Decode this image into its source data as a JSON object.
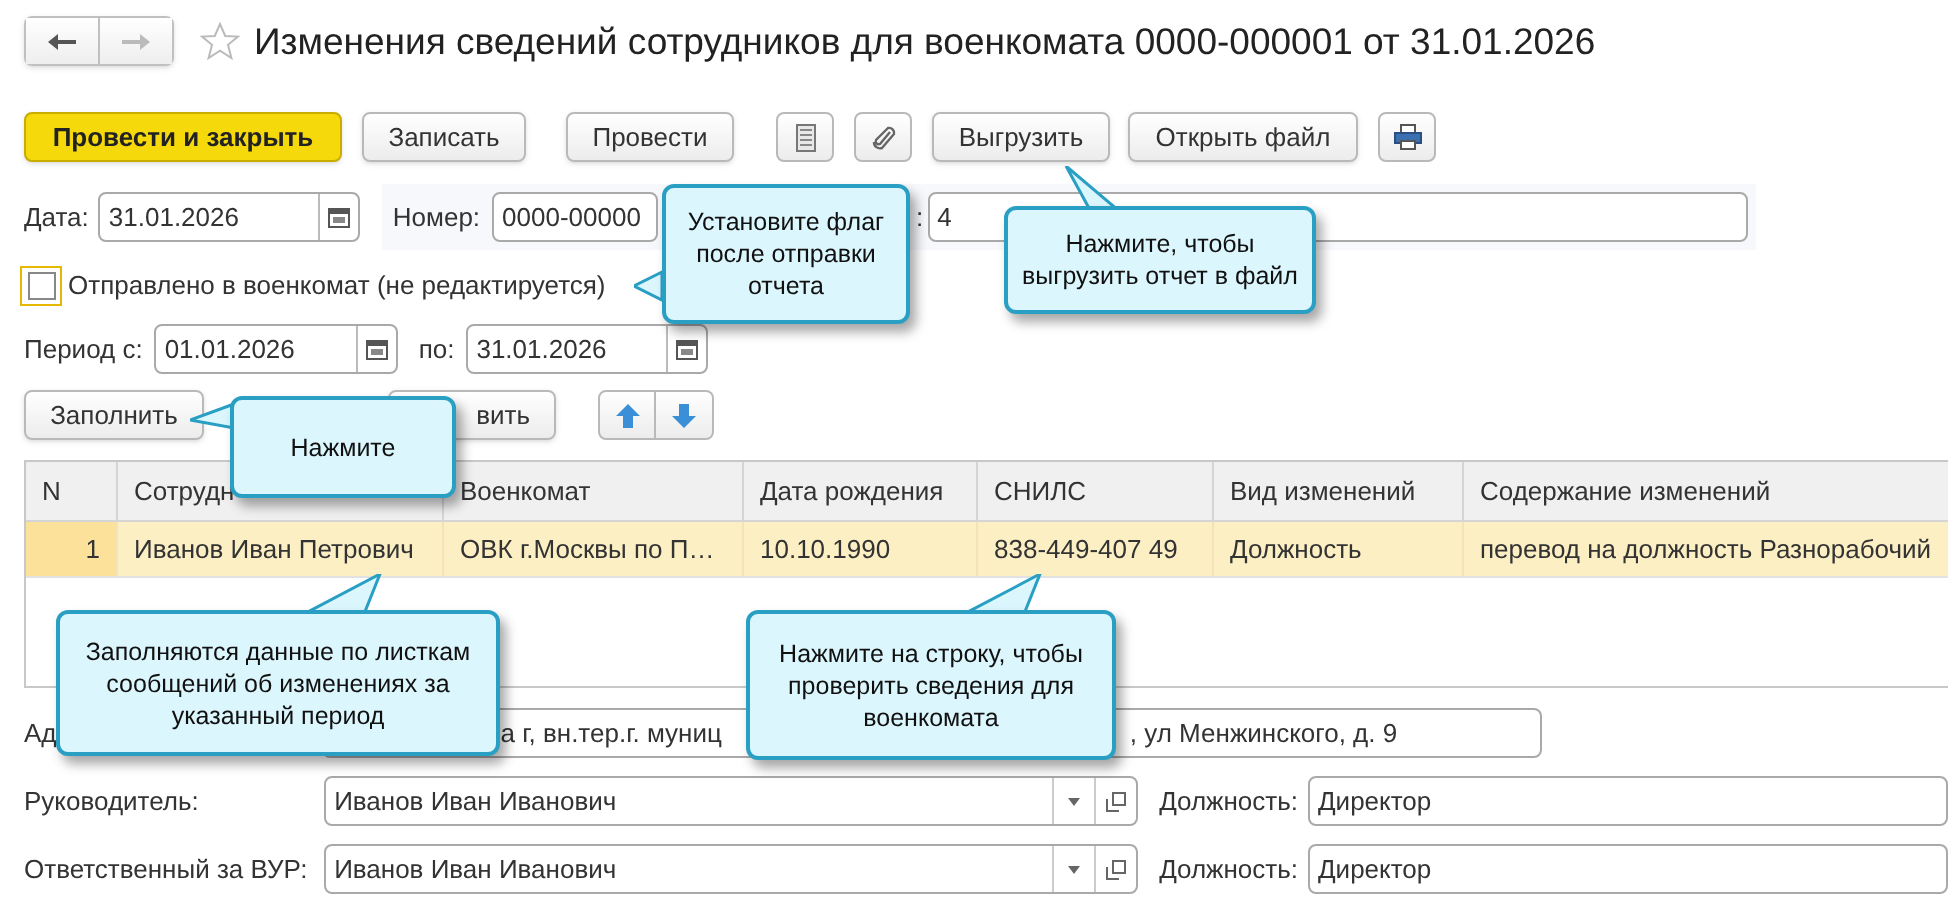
{
  "title": "Изменения сведений сотрудников для военкомата 0000-000001 от 31.01.2026",
  "favorite": false,
  "main_buttons": [
    {
      "kind": "primary",
      "label": "Провести и закрыть"
    },
    {
      "kind": "plain",
      "label": "Записать"
    },
    {
      "kind": "plain",
      "label": "Провести"
    }
  ],
  "file_buttons": [
    {
      "label": "Выгрузить"
    },
    {
      "label": "Открыть файл"
    }
  ],
  "date": {
    "label": "Дата:",
    "value": "31.01.2026"
  },
  "number": {
    "label": "Номер:",
    "value": "0000-00000"
  },
  "field_3": {
    "label": ":",
    "value": "4"
  },
  "sent": {
    "label": "Отправлено в военкомат (не редактируется)",
    "checked": false
  },
  "period": {
    "from_label": "Период с:",
    "from": "01.01.2026",
    "to_label": "по:",
    "to": "31.01.2026"
  },
  "fill_button": "Заполнить",
  "button_3": "вить",
  "table": {
    "columns": [
      "N",
      "Сотрудн",
      "Военкомат",
      "Дата рождения",
      "СНИЛС",
      "Вид изменений",
      "Содержание изменений"
    ],
    "rows": [
      {
        "selected": true,
        "cells": [
          "1",
          "Иванов Иван Петрович",
          "ОВК г.Москвы по П…",
          "10.10.1990",
          "838-449-407 49",
          "Должность",
          "перевод на должность Разнорабочий"
        ]
      }
    ]
  },
  "address": {
    "label": "Ад",
    "value_part_1": "а г, вн.тер.г. муниц",
    "value_part_2": ", ул Менжинского, д. 9"
  },
  "people": [
    {
      "label": "Руководитель:",
      "value": "Иванов Иван Иванович",
      "position_label": "Должность:",
      "position": "Директор"
    },
    {
      "label": "Ответственный за ВУР:",
      "value": "Иванов Иван Иванович",
      "position_label": "Должность:",
      "position": "Директор"
    }
  ],
  "callouts": [
    "Установите флаг после отправки отчета",
    "Нажмите, чтобы выгрузить отчет в файл",
    "Нажмите",
    "Заполняются данные по листкам сообщений об изменениях за указанный период",
    "Нажмите на строку, чтобы проверить сведения для военкомата"
  ]
}
